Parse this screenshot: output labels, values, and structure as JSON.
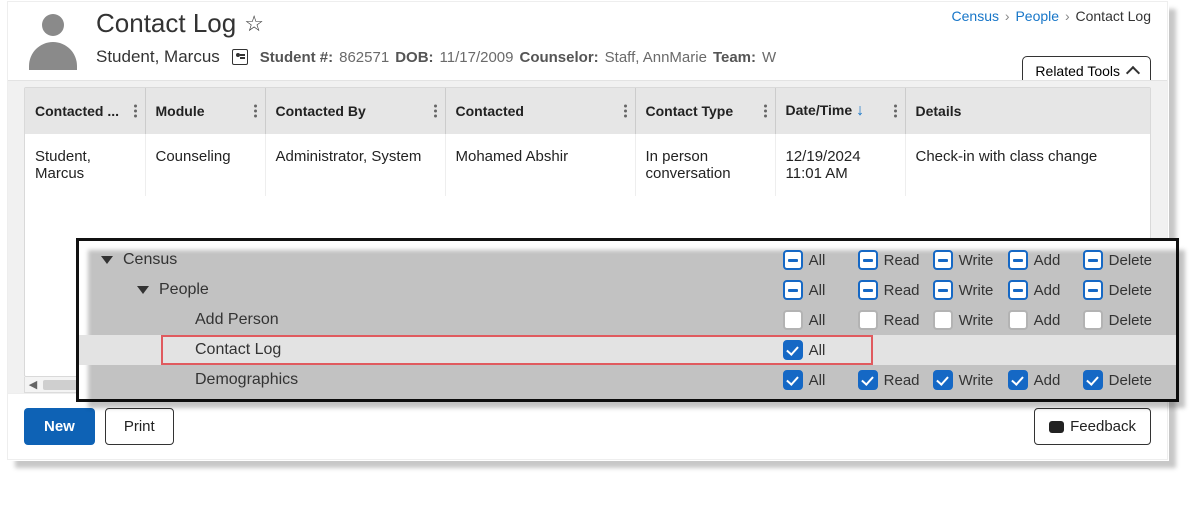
{
  "breadcrumb": {
    "a": "Census",
    "b": "People",
    "c": "Contact Log"
  },
  "title": "Contact Log",
  "related_tools": "Related Tools",
  "student": {
    "name": "Student, Marcus",
    "num_label": "Student #:",
    "num": "862571",
    "dob_label": "DOB:",
    "dob": "11/17/2009",
    "counselor_label": "Counselor:",
    "counselor": "Staff, AnnMarie",
    "team_label": "Team:",
    "team": "W"
  },
  "columns": {
    "c1": "Contacted ...",
    "c2": "Module",
    "c3": "Contacted By",
    "c4": "Contacted",
    "c5": "Contact Type",
    "c6": "Date/Time",
    "c7": "Details"
  },
  "row": {
    "c1": "Student, Marcus",
    "c2": "Counseling",
    "c3": "Administrator, System",
    "c4": "Mohamed Abshir",
    "c5": "In person conversation",
    "c6": "12/19/2024 11:01 AM",
    "c7": "Check-in with class change"
  },
  "buttons": {
    "new": "New",
    "print": "Print",
    "feedback": "Feedback"
  },
  "tree": {
    "census": "Census",
    "people": "People",
    "add_person": "Add Person",
    "contact_log": "Contact Log",
    "demographics": "Demographics"
  },
  "perm_labels": {
    "all": "All",
    "read": "Read",
    "write": "Write",
    "add": "Add",
    "delete": "Delete"
  }
}
